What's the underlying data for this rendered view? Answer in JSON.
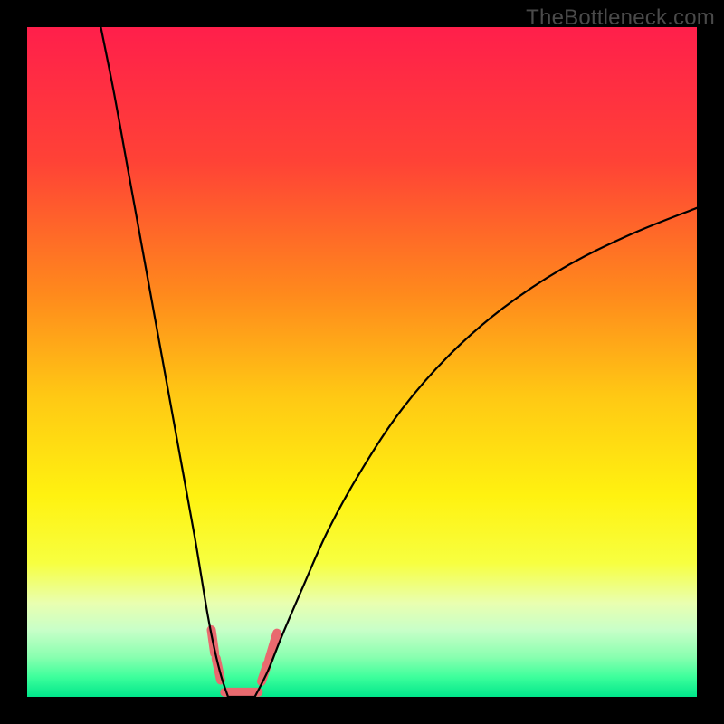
{
  "watermark": "TheBottleneck.com",
  "chart_data": {
    "type": "line",
    "title": "",
    "xlabel": "",
    "ylabel": "",
    "xlim": [
      0,
      100
    ],
    "ylim": [
      0,
      100
    ],
    "grid": false,
    "legend": null,
    "background": {
      "type": "vertical-gradient",
      "stops": [
        {
          "offset": 0.0,
          "color": "#ff1f4b"
        },
        {
          "offset": 0.2,
          "color": "#ff4236"
        },
        {
          "offset": 0.4,
          "color": "#ff8a1c"
        },
        {
          "offset": 0.55,
          "color": "#ffc814"
        },
        {
          "offset": 0.7,
          "color": "#fff210"
        },
        {
          "offset": 0.8,
          "color": "#f7ff40"
        },
        {
          "offset": 0.86,
          "color": "#e9ffb0"
        },
        {
          "offset": 0.9,
          "color": "#c8ffc8"
        },
        {
          "offset": 0.94,
          "color": "#8affb0"
        },
        {
          "offset": 0.97,
          "color": "#3eff9c"
        },
        {
          "offset": 1.0,
          "color": "#00e78b"
        }
      ]
    },
    "series": [
      {
        "name": "left-branch",
        "stroke": "#000000",
        "strokeWidth": 2.2,
        "x": [
          11,
          13,
          15,
          17,
          19,
          21,
          23,
          25,
          26,
          27,
          28,
          29,
          30
        ],
        "y": [
          100,
          90,
          79,
          68,
          57,
          46,
          35,
          24,
          18,
          12,
          7,
          3,
          0
        ]
      },
      {
        "name": "right-branch",
        "stroke": "#000000",
        "strokeWidth": 2.2,
        "x": [
          34,
          36,
          38,
          41,
          45,
          50,
          56,
          63,
          71,
          80,
          90,
          100
        ],
        "y": [
          0,
          4,
          9,
          16,
          25,
          34,
          43,
          51,
          58,
          64,
          69,
          73
        ]
      },
      {
        "name": "valley-floor",
        "stroke": "#000000",
        "strokeWidth": 2.2,
        "x": [
          30,
          31,
          32,
          33,
          34
        ],
        "y": [
          0,
          0,
          0,
          0,
          0
        ]
      }
    ],
    "sweet_spot_markers": {
      "stroke": "#e96a6f",
      "strokeWidth": 10,
      "segments": [
        {
          "x": [
            27.5,
            28.0
          ],
          "y": [
            10.0,
            6.5
          ]
        },
        {
          "x": [
            28.2,
            28.9
          ],
          "y": [
            5.8,
            2.5
          ]
        },
        {
          "x": [
            29.5,
            34.5
          ],
          "y": [
            0.7,
            0.7
          ]
        },
        {
          "x": [
            35.0,
            35.9
          ],
          "y": [
            2.3,
            5.0
          ]
        },
        {
          "x": [
            36.1,
            37.3
          ],
          "y": [
            5.5,
            9.5
          ]
        }
      ]
    }
  }
}
